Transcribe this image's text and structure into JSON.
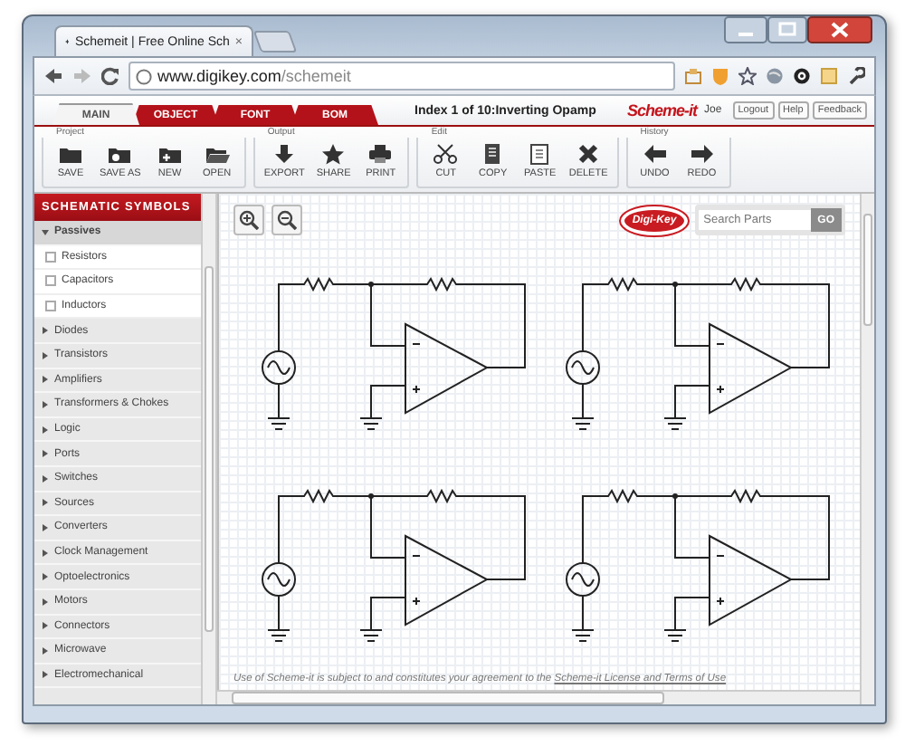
{
  "browser": {
    "tab": {
      "title": "Schemeit | Free Online Sch",
      "close": "×"
    },
    "address": {
      "host": "www.digikey.com",
      "path": "/schemeit"
    }
  },
  "app": {
    "tabs": [
      {
        "label": "MAIN",
        "selected": true
      },
      {
        "label": "OBJECT",
        "selected": false
      },
      {
        "label": "FONT",
        "selected": false
      },
      {
        "label": "BOM",
        "selected": false
      }
    ],
    "document_title": "Index 1 of 10:Inverting Opamp",
    "logo": "Scheme-it",
    "user": "Joe",
    "buttons": [
      "Logout",
      "Help",
      "Feedback"
    ]
  },
  "toolbar": [
    {
      "label": "Project",
      "buttons": [
        "SAVE",
        "SAVE AS",
        "NEW",
        "OPEN"
      ]
    },
    {
      "label": "Output",
      "buttons": [
        "EXPORT",
        "SHARE",
        "PRINT"
      ]
    },
    {
      "label": "Edit",
      "buttons": [
        "CUT",
        "COPY",
        "PASTE",
        "DELETE"
      ]
    },
    {
      "label": "History",
      "buttons": [
        "UNDO",
        "REDO"
      ]
    }
  ],
  "sidebar": {
    "title": "SCHEMATIC SYMBOLS",
    "categories": [
      {
        "label": "Passives",
        "expanded": true,
        "children": [
          {
            "label": "Resistors"
          },
          {
            "label": "Capacitors"
          },
          {
            "label": "Inductors"
          }
        ]
      },
      {
        "label": "Diodes",
        "expanded": false
      },
      {
        "label": "Transistors",
        "expanded": false
      },
      {
        "label": "Amplifiers",
        "expanded": false
      },
      {
        "label": "Transformers & Chokes",
        "expanded": false
      },
      {
        "label": "Logic",
        "expanded": false
      },
      {
        "label": "Ports",
        "expanded": false
      },
      {
        "label": "Switches",
        "expanded": false
      },
      {
        "label": "Sources",
        "expanded": false
      },
      {
        "label": "Converters",
        "expanded": false
      },
      {
        "label": "Clock Management",
        "expanded": false
      },
      {
        "label": "Optoelectronics",
        "expanded": false
      },
      {
        "label": "Motors",
        "expanded": false
      },
      {
        "label": "Connectors",
        "expanded": false
      },
      {
        "label": "Microwave",
        "expanded": false
      },
      {
        "label": "Electromechanical",
        "expanded": false
      }
    ]
  },
  "canvas": {
    "vendor_logo": "Digi-Key",
    "search": {
      "placeholder": "Search Parts",
      "button": "GO"
    },
    "footer": {
      "text": "Use of Scheme-it is subject to and constitutes your agreement to the ",
      "link": "Scheme-it License and Terms of Use"
    }
  }
}
